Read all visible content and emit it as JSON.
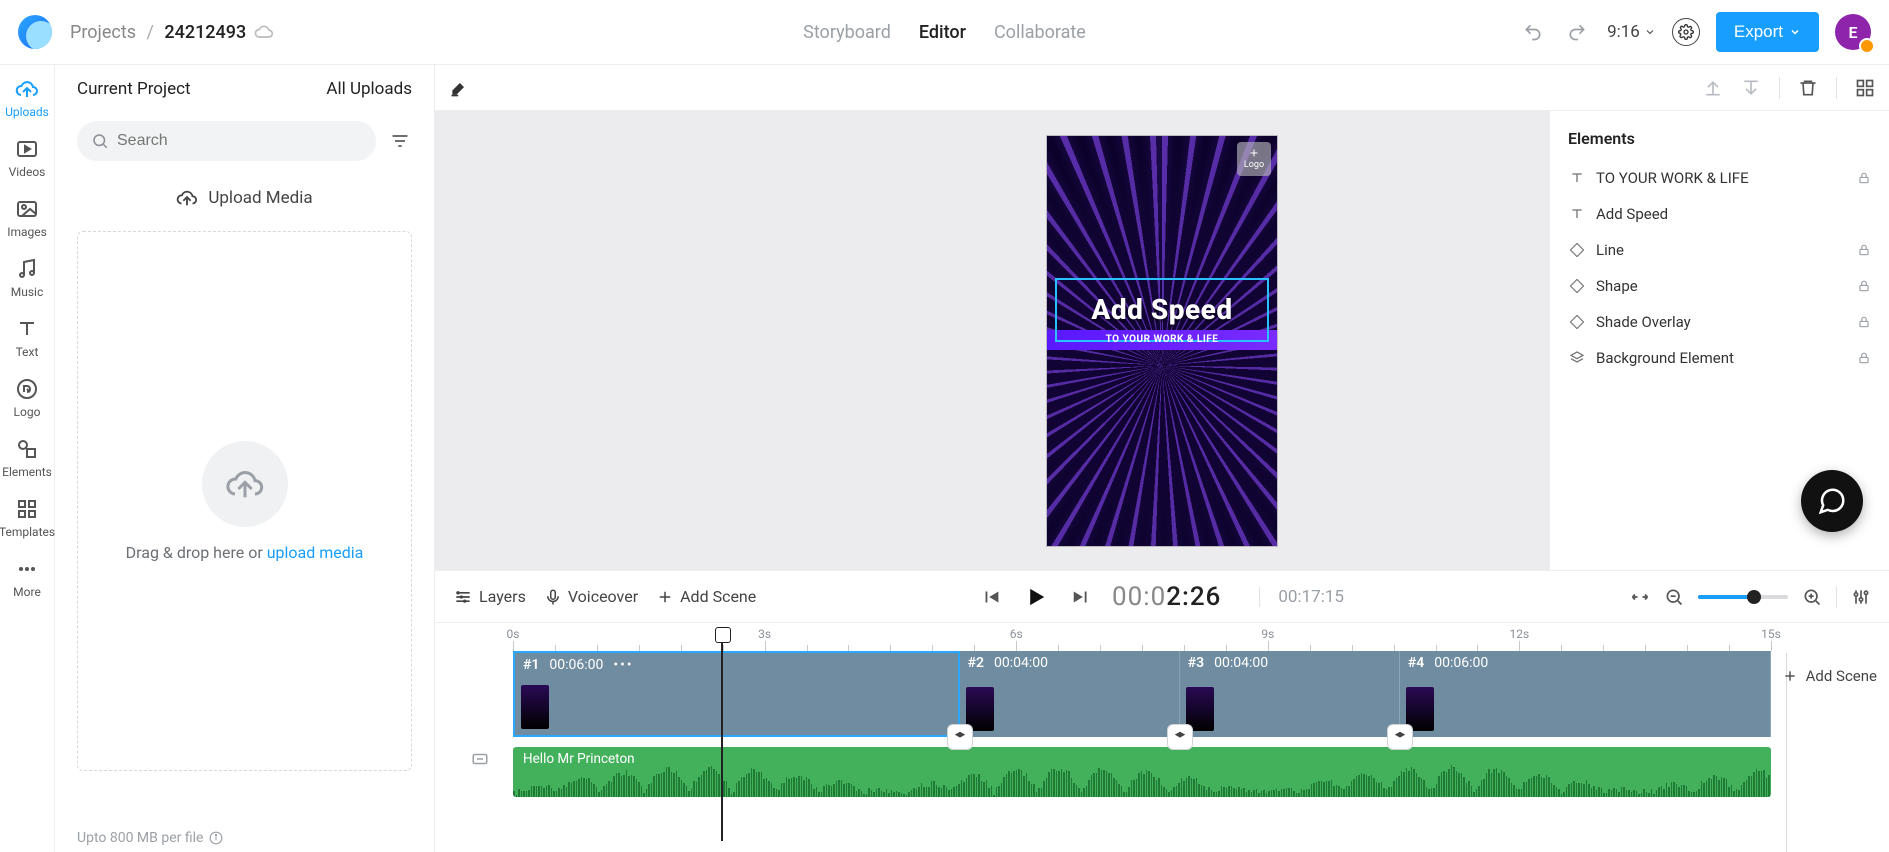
{
  "header": {
    "breadcrumb_root": "Projects",
    "project_name": "24212493",
    "ratio": "9:16",
    "export_label": "Export",
    "avatar_letter": "E",
    "tabs": [
      "Storyboard",
      "Editor",
      "Collaborate"
    ],
    "active_tab": 1
  },
  "rail": {
    "items": [
      {
        "label": "Uploads",
        "icon": "upload"
      },
      {
        "label": "Videos",
        "icon": "video"
      },
      {
        "label": "Images",
        "icon": "image"
      },
      {
        "label": "Music",
        "icon": "music"
      },
      {
        "label": "Text",
        "icon": "text"
      },
      {
        "label": "Logo",
        "icon": "logo"
      },
      {
        "label": "Elements",
        "icon": "elements"
      },
      {
        "label": "Templates",
        "icon": "templates"
      },
      {
        "label": "More",
        "icon": "more"
      }
    ],
    "active": 0
  },
  "left_panel": {
    "tab_a": "Current Project",
    "tab_b": "All Uploads",
    "search_placeholder": "Search",
    "upload_media_label": "Upload Media",
    "dropzone_prefix": "Drag & drop here or ",
    "dropzone_link": "upload media",
    "footer_text": "Upto 800 MB per file"
  },
  "canvas": {
    "headline": "Add Speed",
    "subline": "TO YOUR WORK & LIFE",
    "logo_badge": "Logo"
  },
  "elements": {
    "title": "Elements",
    "items": [
      {
        "label": "TO YOUR WORK & LIFE",
        "icon": "text",
        "locked": true
      },
      {
        "label": "Add Speed",
        "icon": "text",
        "locked": false
      },
      {
        "label": "Line",
        "icon": "shape",
        "locked": true
      },
      {
        "label": "Shape",
        "icon": "shape",
        "locked": true
      },
      {
        "label": "Shade Overlay",
        "icon": "shape",
        "locked": true
      },
      {
        "label": "Background Element",
        "icon": "layers",
        "locked": true
      }
    ]
  },
  "playback": {
    "layers": "Layers",
    "voiceover": "Voiceover",
    "add_scene": "Add Scene",
    "time_prefix": "00:0",
    "time_strong": "2:26",
    "duration": "00:17:15"
  },
  "timeline": {
    "ruler_labels": [
      "0s",
      "3s",
      "6s",
      "9s",
      "12s",
      "15s"
    ],
    "playhead_pct": 16.5,
    "scenes": [
      {
        "tag": "#1",
        "dur": "00:06:00",
        "width_pct": 35.5,
        "selected": true,
        "more": true
      },
      {
        "tag": "#2",
        "dur": "00:04:00",
        "width_pct": 17.5,
        "selected": false
      },
      {
        "tag": "#3",
        "dur": "00:04:00",
        "width_pct": 17.5,
        "selected": false
      },
      {
        "tag": "#4",
        "dur": "00:06:00",
        "width_pct": 29.5,
        "selected": false
      }
    ],
    "audio_title": "Hello Mr Princeton",
    "add_scene_side": "Add Scene"
  }
}
